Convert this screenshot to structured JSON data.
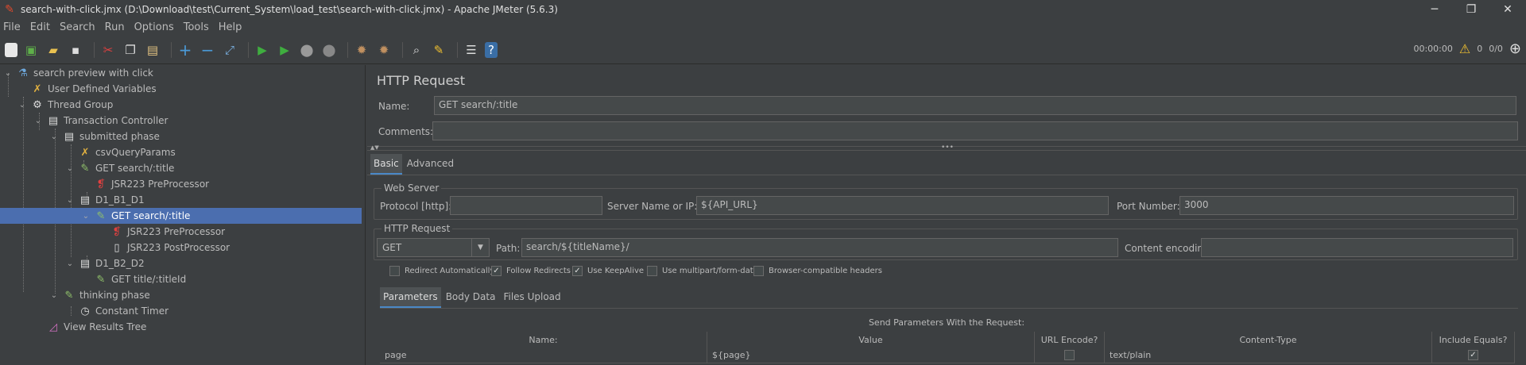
{
  "window": {
    "title": "search-with-click.jmx (D:\\Download\\test\\Current_System\\load_test\\search-with-click.jmx) - Apache JMeter (5.6.3)",
    "minimize": "─",
    "maximize": "❐",
    "close": "✕"
  },
  "menu": [
    "File",
    "Edit",
    "Search",
    "Run",
    "Options",
    "Tools",
    "Help"
  ],
  "toolbar": {
    "timer": "00:00:00",
    "warnings": "0",
    "threads": "0/0"
  },
  "tree": [
    {
      "label": "search preview with click",
      "icon": "flask-icon"
    },
    {
      "label": "User Defined Variables",
      "icon": "wrench-icon"
    },
    {
      "label": "Thread Group",
      "icon": "gear-icon"
    },
    {
      "label": "Transaction Controller",
      "icon": "controller-icon"
    },
    {
      "label": "submitted phase",
      "icon": "controller-icon"
    },
    {
      "label": "csvQueryParams",
      "icon": "wrench-icon"
    },
    {
      "label": "GET search/:title",
      "icon": "pipette-icon"
    },
    {
      "label": "JSR223 PreProcessor",
      "icon": "script-icon"
    },
    {
      "label": "D1_B1_D1",
      "icon": "controller-icon"
    },
    {
      "label": "GET search/:title",
      "icon": "pipette-icon"
    },
    {
      "label": "JSR223 PreProcessor",
      "icon": "script-icon"
    },
    {
      "label": "JSR223 PostProcessor",
      "icon": "doc-icon"
    },
    {
      "label": "D1_B2_D2",
      "icon": "controller-icon"
    },
    {
      "label": "GET title/:titleId",
      "icon": "pipette-icon"
    },
    {
      "label": "thinking phase",
      "icon": "pipette-icon"
    },
    {
      "label": "Constant Timer",
      "icon": "timer-icon"
    },
    {
      "label": "View Results Tree",
      "icon": "chart-icon"
    }
  ],
  "panel": {
    "title": "HTTP Request",
    "name_label": "Name:",
    "name_value": "GET search/:title",
    "comments_label": "Comments:",
    "comments_value": "",
    "tabs": [
      "Basic",
      "Advanced"
    ],
    "webserver": {
      "legend": "Web Server",
      "protocol_label": "Protocol [http]:",
      "protocol_value": "",
      "server_label": "Server Name or IP:",
      "server_value": "${API_URL}",
      "port_label": "Port Number:",
      "port_value": "3000"
    },
    "httpreq": {
      "legend": "HTTP Request",
      "method": "GET",
      "path_label": "Path:",
      "path_value": "search/${titleName}/",
      "encoding_label": "Content encoding:",
      "encoding_value": ""
    },
    "checks": [
      {
        "label": "Redirect Automatically",
        "checked": false
      },
      {
        "label": "Follow Redirects",
        "checked": true
      },
      {
        "label": "Use KeepAlive",
        "checked": true
      },
      {
        "label": "Use multipart/form-data",
        "checked": false
      },
      {
        "label": "Browser-compatible headers",
        "checked": false
      }
    ],
    "subtabs": [
      "Parameters",
      "Body Data",
      "Files Upload"
    ],
    "send_params": "Send Parameters With the Request:",
    "table": {
      "headers": [
        "Name:",
        "Value",
        "URL Encode?",
        "Content-Type",
        "Include Equals?"
      ],
      "rows": [
        {
          "name": "page",
          "value": "${page}",
          "url_encode": false,
          "content_type": "text/plain",
          "include_equals": true
        }
      ]
    }
  }
}
